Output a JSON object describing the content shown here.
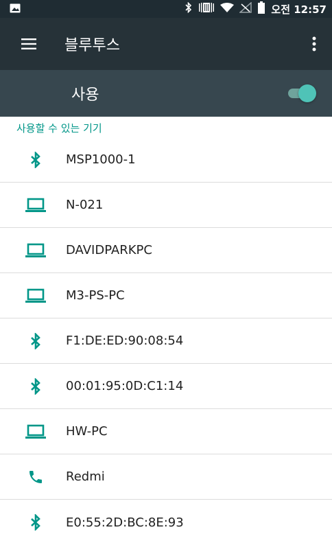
{
  "status_bar": {
    "icons": [
      "image-icon",
      "bluetooth-icon",
      "vibrate-icon",
      "wifi-icon",
      "no-signal-icon",
      "battery-icon"
    ],
    "clock": "오전 12:57"
  },
  "app_bar": {
    "menu_icon": "hamburger-menu-icon",
    "title": "블루투스",
    "overflow_icon": "more-vert-icon"
  },
  "master_switch": {
    "label": "사용",
    "on": true
  },
  "colors": {
    "status_bar": "#1f2c33",
    "app_bar": "#263238",
    "switch_bar": "#37474f",
    "accent": "#009688",
    "toggle_thumb": "#4fc3b7",
    "text_primary": "#212121"
  },
  "available_devices": {
    "header": "사용할 수 있는 기기",
    "items": [
      {
        "icon": "bluetooth-icon",
        "name": "MSP1000-1"
      },
      {
        "icon": "laptop-icon",
        "name": "N-021"
      },
      {
        "icon": "laptop-icon",
        "name": "DAVIDPARKPC"
      },
      {
        "icon": "laptop-icon",
        "name": "M3-PS-PC"
      },
      {
        "icon": "bluetooth-icon",
        "name": "F1:DE:ED:90:08:54"
      },
      {
        "icon": "bluetooth-icon",
        "name": "00:01:95:0D:C1:14"
      },
      {
        "icon": "laptop-icon",
        "name": "HW-PC"
      },
      {
        "icon": "phone-icon",
        "name": "Redmi"
      },
      {
        "icon": "bluetooth-icon",
        "name": "E0:55:2D:BC:8E:93"
      }
    ]
  }
}
